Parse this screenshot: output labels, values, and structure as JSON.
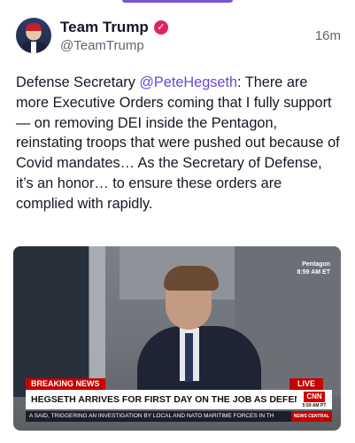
{
  "post": {
    "author_name": "Team Trump",
    "author_handle": "@TeamTrump",
    "timestamp": "16m",
    "text_before_mention": "Defense Secretary ",
    "mention": "@PeteHegseth",
    "text_after_mention": ": There are more Executive Orders coming that I fully support — on removing DEI inside the Pentagon, reinstating troops that were pushed out because of Covid mandates… As the Secretary of Defense, it’s an honor… to ensure these orders are complied with rapidly."
  },
  "media": {
    "location_tag": "Pentagon",
    "time_tag": "8:59 AM ET",
    "breaking_label": "BREAKING NEWS",
    "live_label": "LIVE",
    "headline": "HEGSETH ARRIVES FOR FIRST DAY ON THE JOB AS DEFENSE SECRETARY",
    "network_logo": "CNN",
    "network_time": "5:59 AM PT",
    "ticker_text": "A SAID, TRIGGERING AN INVESTIGATION BY LOCAL AND NATO MARITIME FORCES IN TH",
    "ticker_tag": "NEWS CENTRAL"
  },
  "icons": {
    "verified": "verified-badge-icon"
  },
  "colors": {
    "accent": "#7b53d6",
    "mention": "#6a48d7",
    "verified_badge": "#e0245e",
    "breaking_red": "#c60000"
  }
}
